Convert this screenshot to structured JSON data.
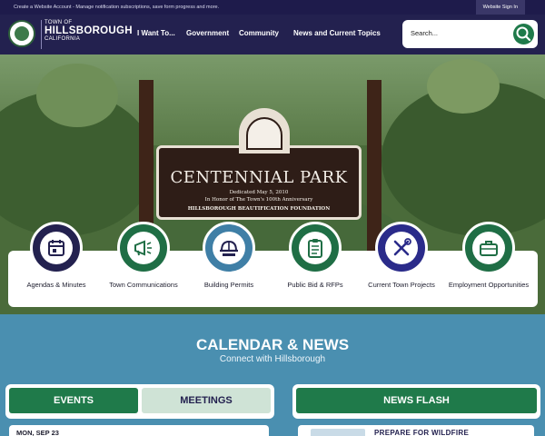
{
  "topbar": {
    "promo": "Create a Website Account - Manage notification subscriptions, save form progress and more.",
    "signin": "Website Sign In"
  },
  "brand": {
    "line1": "TOWN OF",
    "line2": "HILLSBOROUGH",
    "line3": "CALIFORNIA"
  },
  "nav": [
    "I Want To...",
    "Government",
    "Community",
    "News and Current Topics"
  ],
  "search": {
    "placeholder": "Search..."
  },
  "hero": {
    "sign_title": "CENTENNIAL PARK",
    "sign_line1": "Dedicated May 5, 2010",
    "sign_line2": "In Honor of The Town's 100th Anniversary",
    "sign_line3": "HILLSBOROUGH BEAUTIFICATION FOUNDATION"
  },
  "quick_links": [
    {
      "label": "Agendas & Minutes",
      "icon": "calendar-icon",
      "color": "#23214f"
    },
    {
      "label": "Town Communications",
      "icon": "megaphone-icon",
      "color": "#1f6e45"
    },
    {
      "label": "Building Permits",
      "icon": "hardhat-icon",
      "color": "#3f7fa6"
    },
    {
      "label": "Public Bid & RFPs",
      "icon": "clipboard-icon",
      "color": "#1f6e45"
    },
    {
      "label": "Current Town Projects",
      "icon": "tools-icon",
      "color": "#2a2b8a"
    },
    {
      "label": "Employment Opportunities",
      "icon": "briefcase-icon",
      "color": "#1f6e45"
    }
  ],
  "calendar": {
    "title": "CALENDAR & NEWS",
    "subtitle": "Connect with Hillsborough",
    "tab_events": "EVENTS",
    "tab_meetings": "MEETINGS",
    "tab_news": "NEWS FLASH",
    "event_preview": "MON, SEP 23",
    "news_preview": "PREPARE FOR WILDFIRE"
  },
  "colors": {
    "navy": "#23214f",
    "green": "#1f7a4a",
    "blue": "#4a8fb0",
    "light_green": "#cfe3d6"
  }
}
